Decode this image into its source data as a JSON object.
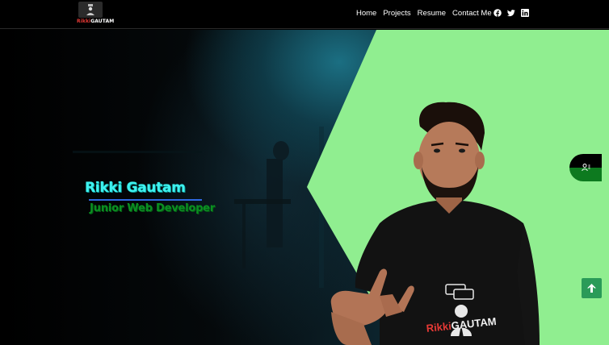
{
  "nav": {
    "logo": {
      "prefix": "Rikki",
      "suffix": "GAUTAM"
    },
    "links": [
      "Home",
      "Projects",
      "Resume",
      "Contact Me"
    ],
    "social_icons": [
      "facebook-icon",
      "twitter-icon",
      "linkedin-icon"
    ]
  },
  "hero": {
    "name": "Rikki Gautam",
    "role": "Junior Web Developer",
    "shirt_logo": {
      "prefix": "Rikki",
      "suffix": "GAUTAM"
    }
  },
  "widgets": {
    "side_button_icon": "contact-card-icon",
    "scroll_top_icon": "arrow-up-icon"
  },
  "colors": {
    "green_panel": "#90ee90",
    "name": "#3ef2ef",
    "role": "#0b8f22",
    "underline": "#2e68e0",
    "logo_red": "#e53935",
    "scroll_button": "#2a9b58"
  }
}
